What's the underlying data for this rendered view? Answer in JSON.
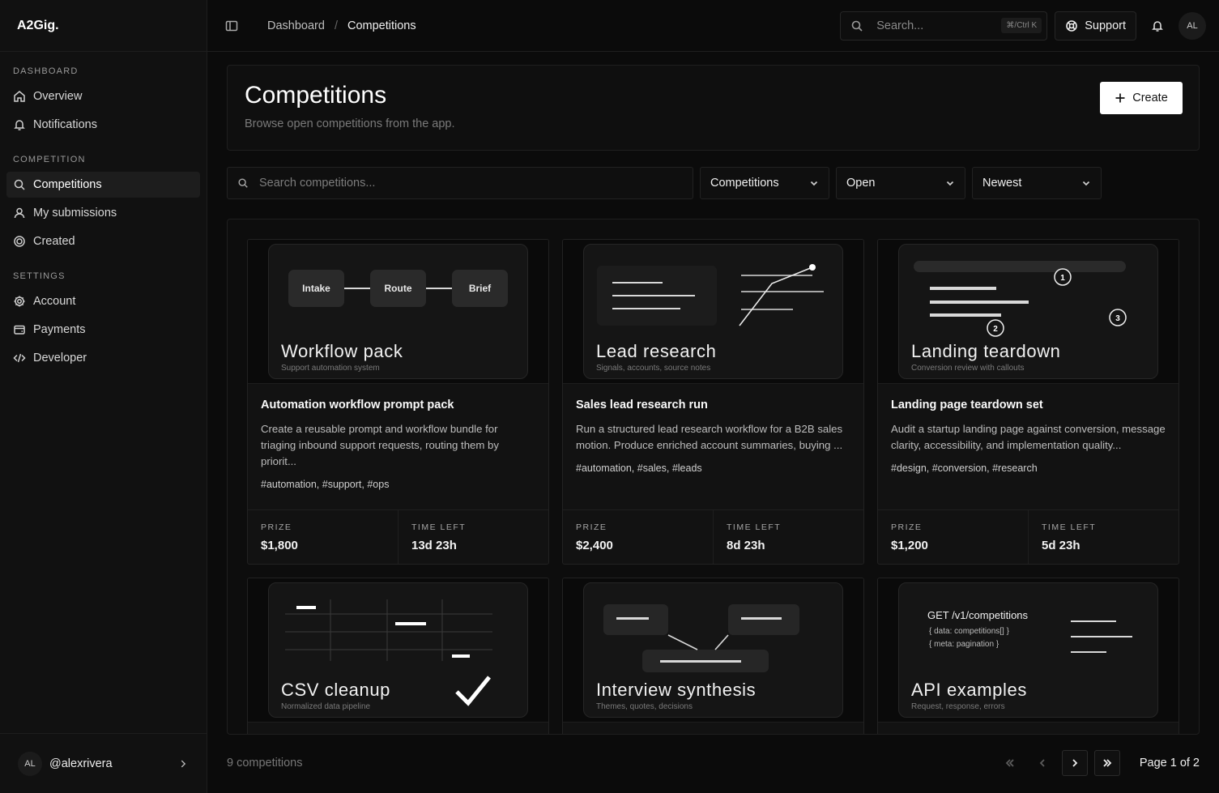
{
  "brand": "A2Gig.",
  "sidebar": {
    "sections": [
      {
        "heading": "DASHBOARD",
        "items": [
          "Overview",
          "Notifications"
        ]
      },
      {
        "heading": "COMPETITION",
        "items": [
          "Competitions",
          "My submissions",
          "Created"
        ]
      },
      {
        "heading": "SETTINGS",
        "items": [
          "Account",
          "Payments",
          "Developer"
        ]
      }
    ],
    "active": "Competitions",
    "user": {
      "initials": "AL",
      "handle": "@alexrivera"
    }
  },
  "topbar": {
    "breadcrumb": [
      "Dashboard",
      "Competitions"
    ],
    "search_placeholder": "Search...",
    "shortcut": "⌘/Ctrl K",
    "support_label": "Support",
    "avatar_initials": "AL"
  },
  "page": {
    "title": "Competitions",
    "subtitle": "Browse open competitions from the app.",
    "create_label": "Create"
  },
  "filters": {
    "search_placeholder": "Search competitions...",
    "type": "Competitions",
    "status": "Open",
    "sort": "Newest"
  },
  "cards": [
    {
      "thumb_title": "Workflow pack",
      "thumb_sub": "Support automation system",
      "thumb_pills": [
        "Intake",
        "Route",
        "Brief"
      ],
      "title": "Automation workflow prompt pack",
      "desc": "Create a reusable prompt and workflow bundle for triaging inbound support requests, routing them by priorit...",
      "tags": "#automation, #support, #ops",
      "prize_label": "PRIZE",
      "prize": "$1,800",
      "time_label": "TIME LEFT",
      "time_left": "13d 23h"
    },
    {
      "thumb_title": "Lead research",
      "thumb_sub": "Signals, accounts, source notes",
      "title": "Sales lead research run",
      "desc": "Run a structured lead research workflow for a B2B sales motion. Produce enriched account summaries, buying ...",
      "tags": "#automation, #sales, #leads",
      "prize_label": "PRIZE",
      "prize": "$2,400",
      "time_label": "TIME LEFT",
      "time_left": "8d 23h"
    },
    {
      "thumb_title": "Landing teardown",
      "thumb_sub": "Conversion review with callouts",
      "thumb_marks": [
        "1",
        "2",
        "3"
      ],
      "title": "Landing page teardown set",
      "desc": "Audit a startup landing page against conversion, message clarity, accessibility, and implementation quality...",
      "tags": "#design, #conversion, #research",
      "prize_label": "PRIZE",
      "prize": "$1,200",
      "time_label": "TIME LEFT",
      "time_left": "5d 23h"
    },
    {
      "thumb_title": "CSV cleanup",
      "thumb_sub": "Normalized data pipeline"
    },
    {
      "thumb_title": "Interview synthesis",
      "thumb_sub": "Themes, quotes, decisions"
    },
    {
      "thumb_title": "API examples",
      "thumb_sub": "Request, response, errors",
      "thumb_code": [
        "GET /v1/competitions",
        "{ data: competitions[] }",
        "{ meta: pagination }"
      ]
    }
  ],
  "footer": {
    "count": "9 competitions",
    "page_label": "Page 1 of 2"
  }
}
